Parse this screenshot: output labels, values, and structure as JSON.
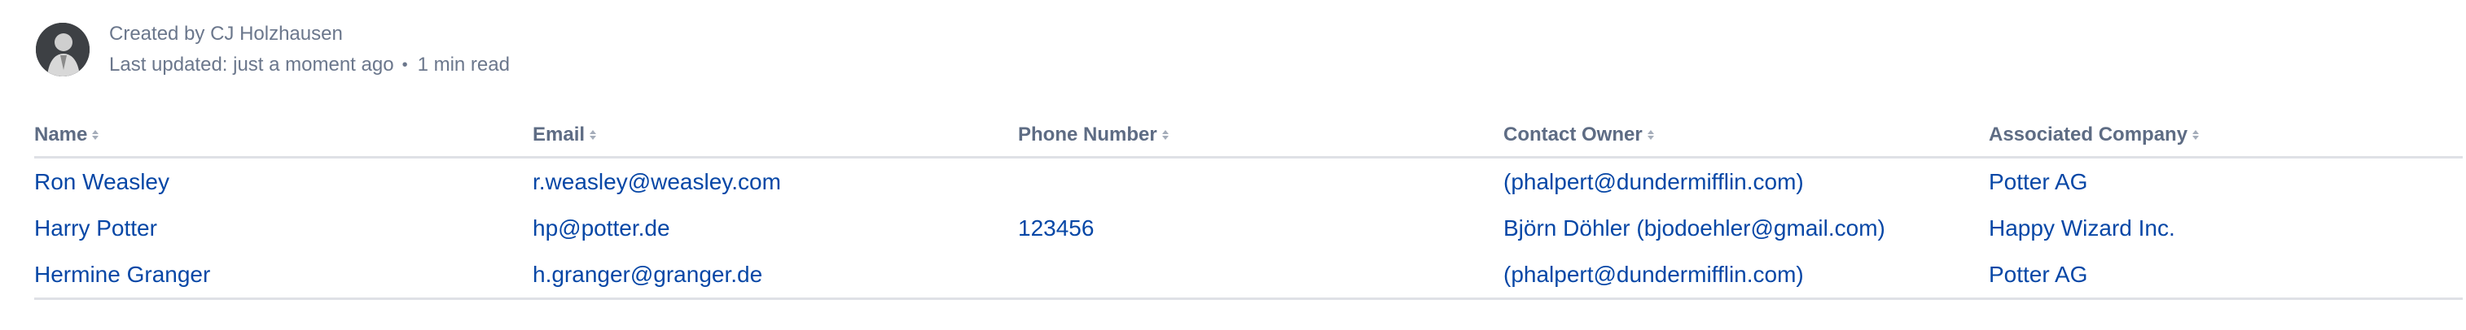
{
  "byline": {
    "created_by": "Created by CJ Holzhausen",
    "last_updated": "Last updated: just a moment ago",
    "separator": "•",
    "read_time": "1 min read",
    "avatar_icon": "user-photo-icon"
  },
  "table": {
    "headers": {
      "name": "Name",
      "email": "Email",
      "phone": "Phone Number",
      "owner": "Contact Owner",
      "company": "Associated Company"
    },
    "sort_icon": "sort-arrows-icon",
    "rows": [
      {
        "name": "Ron Weasley",
        "email": "r.weasley@weasley.com",
        "phone": "",
        "owner": "(phalpert@dundermifflin.com)",
        "company": "Potter AG"
      },
      {
        "name": "Harry Potter",
        "email": "hp@potter.de",
        "phone": "123456",
        "owner": "Björn Döhler (bjodoehler@gmail.com)",
        "company": "Happy Wizard Inc."
      },
      {
        "name": "Hermine Granger",
        "email": "h.granger@granger.de",
        "phone": "",
        "owner": "(phalpert@dundermifflin.com)",
        "company": "Potter AG"
      }
    ]
  },
  "colors": {
    "link": "#0747a6",
    "muted_text": "#6b778c",
    "header_text": "#5e6c84",
    "divider": "#dfe1e6"
  }
}
